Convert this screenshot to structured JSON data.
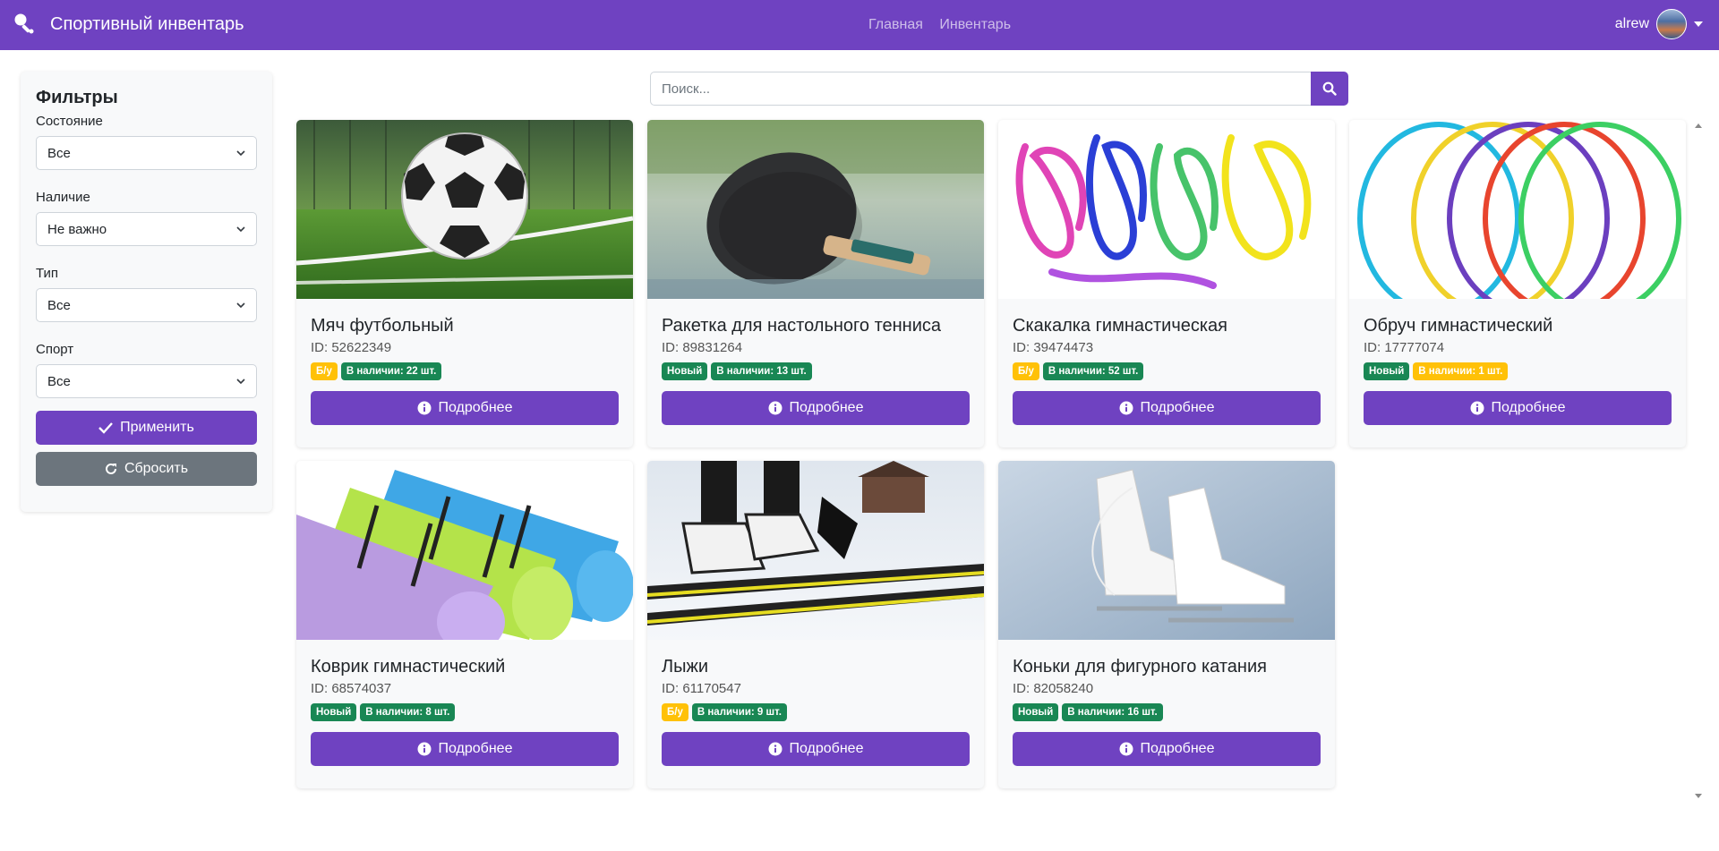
{
  "navbar": {
    "brand": "Спортивный инвентарь",
    "links": [
      "Главная",
      "Инвентарь"
    ],
    "user": "alrew"
  },
  "filters": {
    "title": "Фильтры",
    "groups": [
      {
        "label": "Состояние",
        "value": "Все"
      },
      {
        "label": "Наличие",
        "value": "Не важно"
      },
      {
        "label": "Тип",
        "value": "Все"
      },
      {
        "label": "Спорт",
        "value": "Все"
      }
    ],
    "apply": "Применить",
    "reset": "Сбросить"
  },
  "search": {
    "placeholder": "Поиск..."
  },
  "details_label": "Подробнее",
  "items": [
    {
      "title": "Мяч футбольный",
      "id": "ID: 52622349",
      "condition": "Б/у",
      "cond_color": "yellow",
      "stock": "В наличии: 22 шт.",
      "stock_color": "green",
      "image": "soccer-ball"
    },
    {
      "title": "Ракетка для настольного тенниса",
      "id": "ID: 89831264",
      "condition": "Новый",
      "cond_color": "green",
      "stock": "В наличии: 13 шт.",
      "stock_color": "green",
      "image": "ping-pong-paddle"
    },
    {
      "title": "Скакалка гимнастическая",
      "id": "ID: 39474473",
      "condition": "Б/у",
      "cond_color": "yellow",
      "stock": "В наличии: 52 шт.",
      "stock_color": "green",
      "image": "jump-ropes"
    },
    {
      "title": "Обруч гимнастический",
      "id": "ID: 17777074",
      "condition": "Новый",
      "cond_color": "green",
      "stock": "В наличии: 1 шт.",
      "stock_color": "yellow",
      "image": "hoops"
    },
    {
      "title": "Коврик гимнастический",
      "id": "ID: 68574037",
      "condition": "Новый",
      "cond_color": "green",
      "stock": "В наличии: 8 шт.",
      "stock_color": "green",
      "image": "mats"
    },
    {
      "title": "Лыжи",
      "id": "ID: 61170547",
      "condition": "Б/у",
      "cond_color": "yellow",
      "stock": "В наличии: 9 шт.",
      "stock_color": "green",
      "image": "skis"
    },
    {
      "title": "Коньки для фигурного катания",
      "id": "ID: 82058240",
      "condition": "Новый",
      "cond_color": "green",
      "stock": "В наличии: 16 шт.",
      "stock_color": "green",
      "image": "figure-skates"
    }
  ],
  "colors": {
    "accent": "#6f42c1",
    "success": "#198754",
    "warning": "#ffc107",
    "secondary": "#6c757d"
  }
}
